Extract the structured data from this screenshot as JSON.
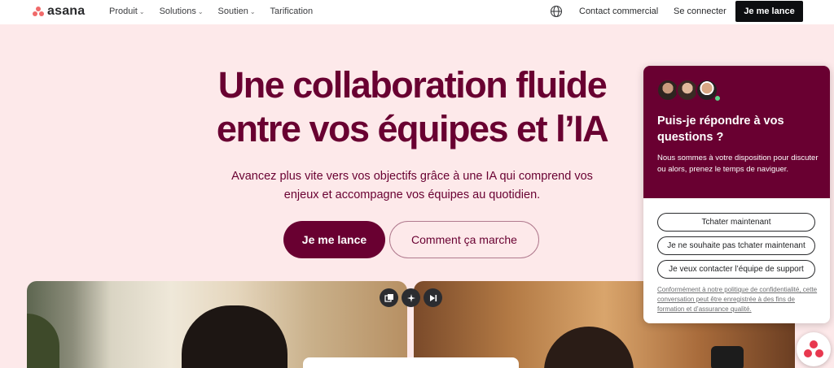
{
  "nav": {
    "logo_text": "asana",
    "links": [
      {
        "label": "Produit",
        "dropdown": true
      },
      {
        "label": "Solutions",
        "dropdown": true
      },
      {
        "label": "Soutien",
        "dropdown": true
      },
      {
        "label": "Tarification",
        "dropdown": false
      }
    ],
    "contact_label": "Contact commercial",
    "signin_label": "Se connecter",
    "cta_label": "Je me lance",
    "chevron": "⌄"
  },
  "hero": {
    "title_line1": "Une collaboration fluide",
    "title_line2": "entre vos équipes et l’IA",
    "subtitle_line1": "Avancez plus vite vers vos objectifs grâce à une IA qui comprend vos",
    "subtitle_line2": "enjeux et accompagne vos équipes au quotidien.",
    "primary_button": "Je me lance",
    "secondary_button": "Comment ça marche"
  },
  "media_controls": [
    "picture-in-picture-icon",
    "sparkle-icon",
    "skip-forward-icon"
  ],
  "chat": {
    "title": "Puis-je répondre à vos questions ?",
    "description": "Nous sommes à votre disposition pour discuter ou alors, prenez le temps de naviguer.",
    "buttons": [
      "Tchater maintenant",
      "Je ne souhaite pas tchater maintenant",
      "Je veux contacter l’équipe de support"
    ],
    "legal": "Conformément à notre politique de confidentialité, cette conversation peut être enregistrée à des fins de formation et d’assurance qualité."
  },
  "colors": {
    "brand_dark": "#690031",
    "background": "#fde9ea",
    "logo_coral": "#f06a6a",
    "nav_cta_bg": "#0d0e10"
  }
}
